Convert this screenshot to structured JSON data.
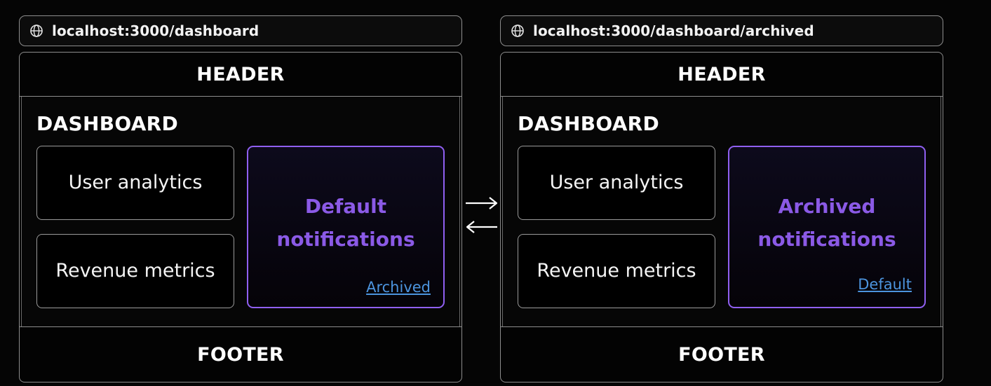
{
  "left": {
    "url": "localhost:3000/dashboard",
    "header": "HEADER",
    "layout_title": "DASHBOARD",
    "slot_user": "User analytics",
    "slot_revenue": "Revenue metrics",
    "notifications_title": "Default notifications",
    "notifications_link": "Archived",
    "footer": "FOOTER"
  },
  "right": {
    "url": "localhost:3000/dashboard/archived",
    "header": "HEADER",
    "layout_title": "DASHBOARD",
    "slot_user": "User analytics",
    "slot_revenue": "Revenue metrics",
    "notifications_title": "Archived notifications",
    "notifications_link": "Default",
    "footer": "FOOTER"
  },
  "icons": {
    "url_icon": "globe-icon",
    "forward": "arrow-right-icon",
    "back": "arrow-left-icon"
  },
  "colors": {
    "background": "#050505",
    "border": "#8d8d8d",
    "accent_purple": "#8b5ae6",
    "link_blue": "#4c94de"
  }
}
